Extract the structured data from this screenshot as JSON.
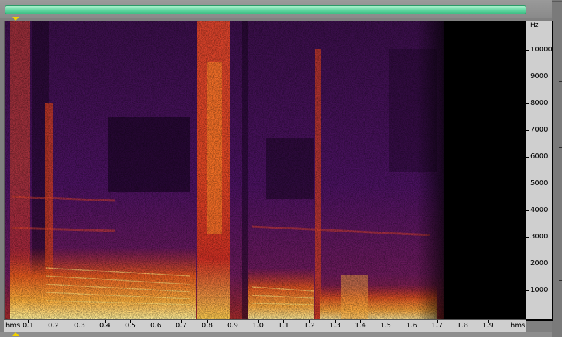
{
  "scroll_bar": {
    "state": "visible"
  },
  "frequency_axis": {
    "unit": "Hz",
    "labels": [
      "10000",
      "9000",
      "8000",
      "7000",
      "6000",
      "5000",
      "4000",
      "3000",
      "2000",
      "1000"
    ]
  },
  "time_axis": {
    "unit_left": "hms",
    "unit_right": "hms",
    "labels": [
      "0.1",
      "0.2",
      "0.3",
      "0.4",
      "0.5",
      "0.6",
      "0.7",
      "0.8",
      "0.9",
      "1.0",
      "1.1",
      "1.2",
      "1.3",
      "1.4",
      "1.5",
      "1.6",
      "1.7",
      "1.8",
      "1.9"
    ]
  },
  "colors": {
    "background": "#808080",
    "scroll_thumb": "#5fd59f",
    "marker": "#f0d000",
    "spectrogram_low": "#000000",
    "spectrogram_high": "#ffff9e"
  }
}
